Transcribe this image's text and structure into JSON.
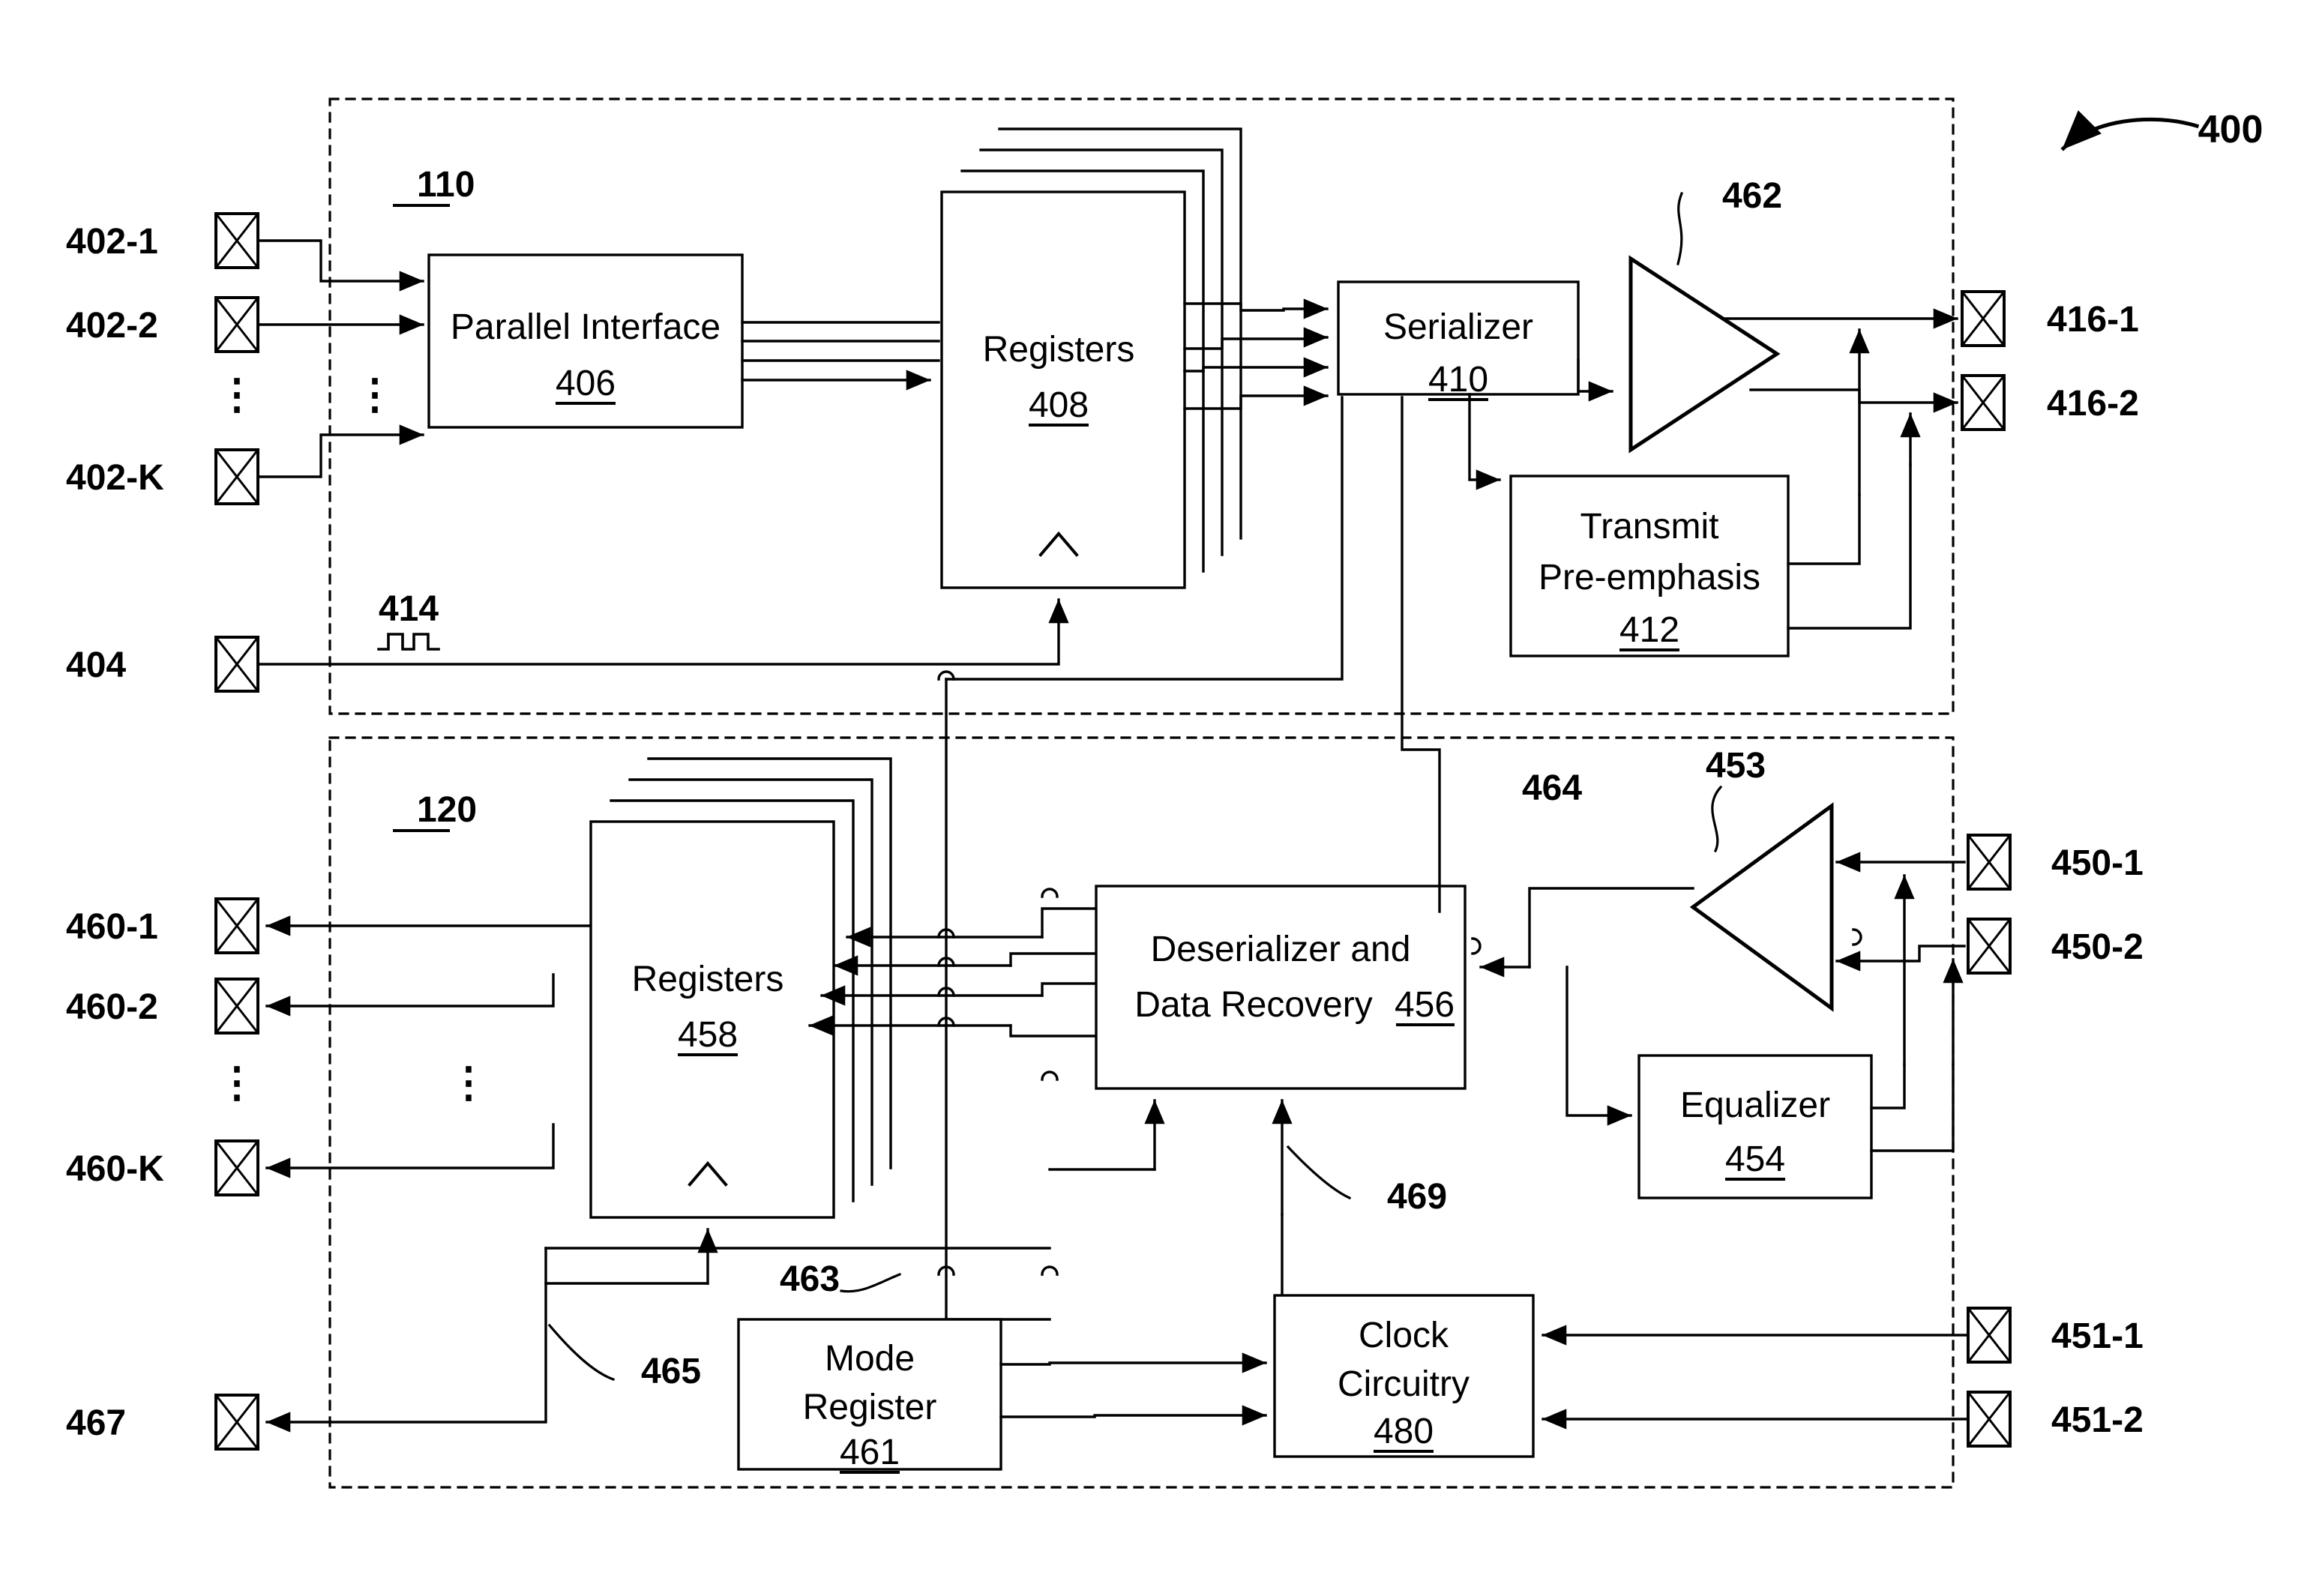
{
  "figure": {
    "number": "400",
    "transmitter_group_ref": "110",
    "receiver_group_ref": "120"
  },
  "transmitter": {
    "group_label": "110",
    "input_pads": [
      {
        "label": "402-1"
      },
      {
        "label": "402-2"
      },
      {
        "label": "402-K"
      }
    ],
    "ellipsis": "⋮",
    "clock_pad": {
      "label": "404"
    },
    "clock_net": {
      "label": "414"
    },
    "blocks": {
      "parallel_interface": {
        "title": "Parallel Interface",
        "ref": "406"
      },
      "registers": {
        "title": "Registers",
        "ref": "408"
      },
      "serializer": {
        "title": "Serializer",
        "ref": "410"
      },
      "pre_emphasis": {
        "title_line1": "Transmit",
        "title_line2": "Pre-emphasis",
        "ref": "412"
      }
    },
    "driver_amp_ref": "462",
    "output_pads": [
      {
        "label": "416-1"
      },
      {
        "label": "416-2"
      }
    ]
  },
  "receiver": {
    "group_label": "120",
    "output_pads": [
      {
        "label": "460-1"
      },
      {
        "label": "460-2"
      },
      {
        "label": "460-K"
      }
    ],
    "ellipsis": "⋮",
    "status_pad": {
      "label": "467"
    },
    "blocks": {
      "registers": {
        "title": "Registers",
        "ref": "458"
      },
      "deserializer": {
        "title_line1": "Deserializer and",
        "title_line2": "Data Recovery",
        "ref": "456"
      },
      "equalizer": {
        "title": "Equalizer",
        "ref": "454"
      },
      "mode_register": {
        "title_line1": "Mode",
        "title_line2": "Register",
        "ref": "461"
      },
      "clock_circuitry": {
        "title_line1": "Clock",
        "title_line2": "Circuitry",
        "ref": "480"
      }
    },
    "receiver_amp_ref": "453",
    "input_pads": [
      {
        "label": "450-1"
      },
      {
        "label": "450-2"
      }
    ],
    "clock_pads": [
      {
        "label": "451-1"
      },
      {
        "label": "451-2"
      }
    ],
    "net_labels": [
      {
        "label": "464"
      },
      {
        "label": "463"
      },
      {
        "label": "465"
      },
      {
        "label": "469"
      }
    ]
  },
  "colors": {
    "line": "#000000",
    "background": "#ffffff"
  }
}
